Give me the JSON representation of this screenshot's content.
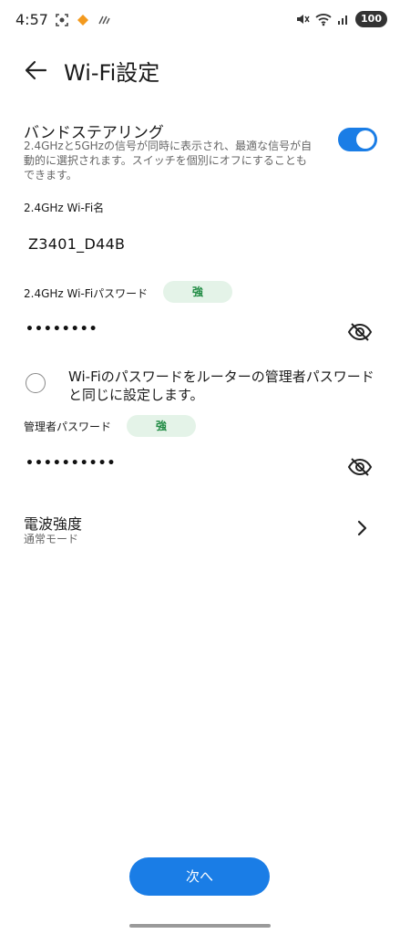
{
  "status_bar": {
    "time": "4:57",
    "battery": "100"
  },
  "header": {
    "title": "Wi-Fi設定"
  },
  "band_steering": {
    "title": "バンドステアリング",
    "description": "2.4GHzと5GHzの信号が同時に表示され、最適な信号が自動的に選択されます。スイッチを個別にオフにすることもできます。",
    "enabled": true
  },
  "ssid": {
    "label": "2.4GHz Wi-Fi名",
    "value": "Z3401_D44B"
  },
  "wifi_password": {
    "label": "2.4GHz Wi-Fiパスワード",
    "strength": "強",
    "masked_value": "••••••••"
  },
  "same_as_admin": {
    "text": "Wi-Fiのパスワードをルーターの管理者パスワードと同じに設定します。",
    "checked": false
  },
  "admin_password": {
    "label": "管理者パスワード",
    "strength": "強",
    "masked_value": "••••••••••"
  },
  "radio_strength": {
    "title": "電波強度",
    "value": "通常モード"
  },
  "next_button": {
    "label": "次へ"
  },
  "colors": {
    "accent": "#1a7de6",
    "badge_bg": "#e4f3e8",
    "badge_text": "#1e8a42"
  }
}
